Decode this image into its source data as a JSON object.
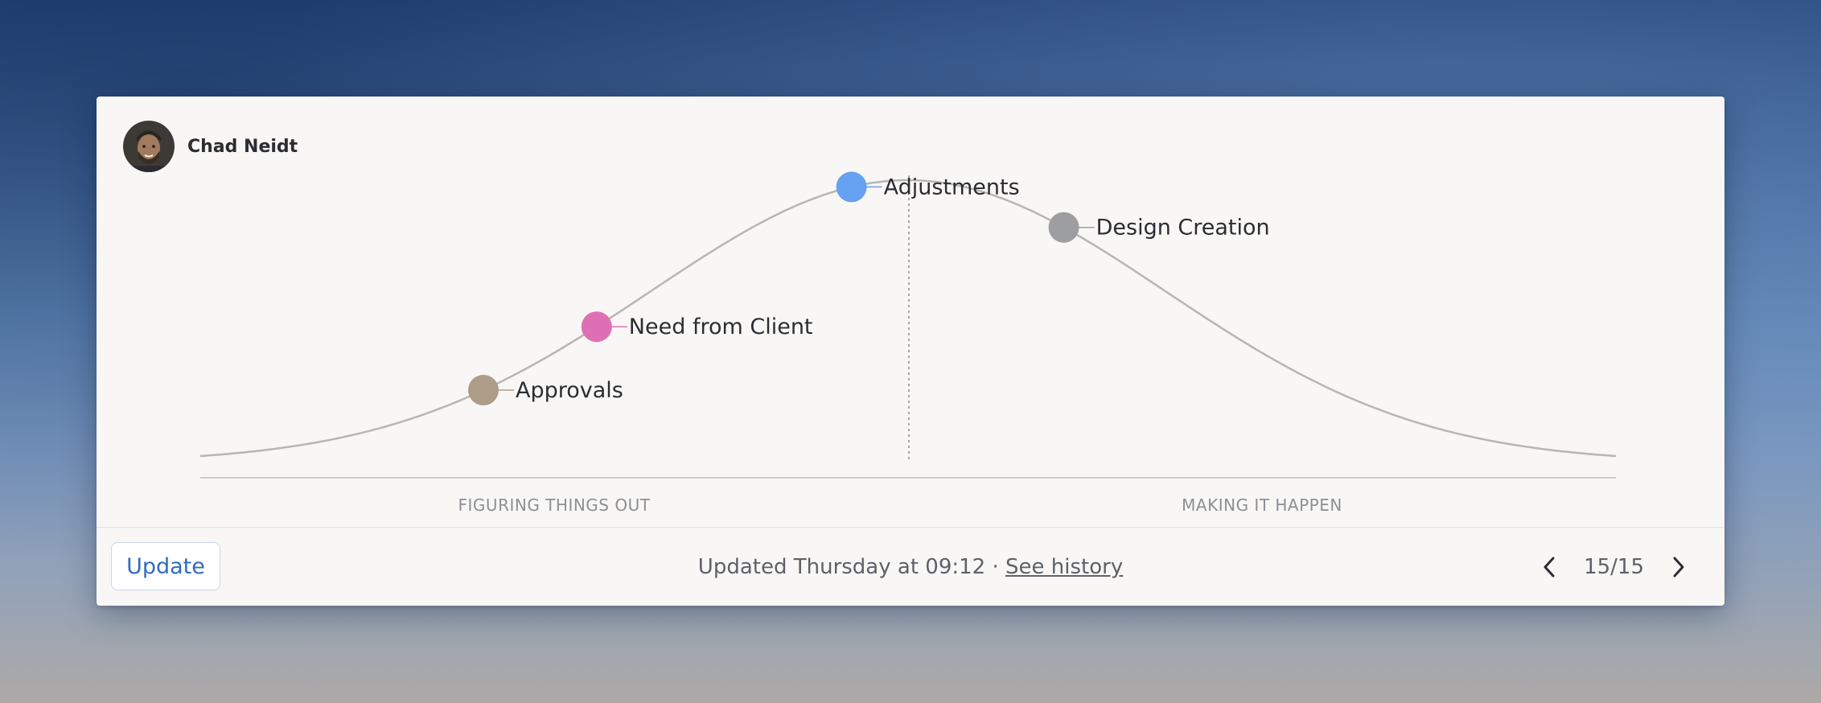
{
  "person": {
    "name": "Chad Neidt"
  },
  "hill": {
    "left_label": "FIGURING THINGS OUT",
    "right_label": "MAKING IT HAPPEN",
    "items": [
      {
        "label": "Approvals",
        "position": 20,
        "color": "#ad9c88"
      },
      {
        "label": "Need from Client",
        "position": 28,
        "color": "#df6fb5"
      },
      {
        "label": "Adjustments",
        "position": 46,
        "color": "#66a1f2"
      },
      {
        "label": "Design Creation",
        "position": 61,
        "color": "#9c9ea0"
      }
    ]
  },
  "footer": {
    "update_label": "Update",
    "status_text": "Updated Thursday at 09:12 · ",
    "history_link": "See history",
    "page_indicator": "15/15"
  },
  "colors": {
    "accent": "#2f6bc2",
    "curve": "#b9b6b1"
  }
}
